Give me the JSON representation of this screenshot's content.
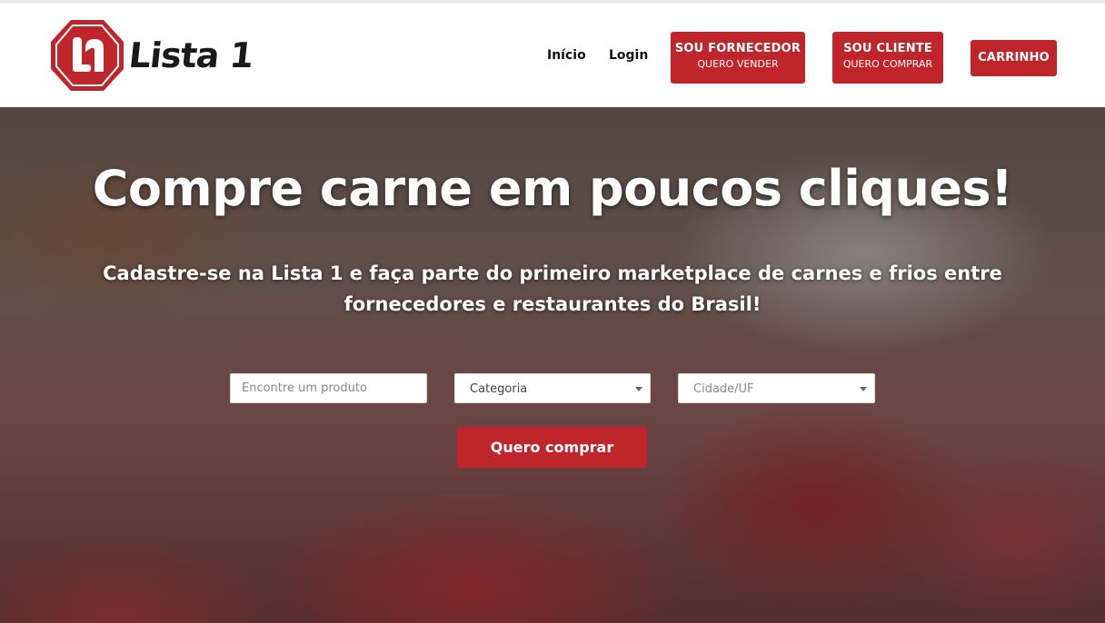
{
  "brand": {
    "name": "Lista 1",
    "badge_letters": "L1",
    "accent_color": "#c0252b"
  },
  "nav": {
    "inicio": "Início",
    "login": "Login",
    "fornecedor_line1": "SOU FORNECEDOR",
    "fornecedor_line2": "QUERO VENDER",
    "cliente_line1": "SOU CLIENTE",
    "cliente_line2": "QUERO COMPRAR",
    "carrinho": "CARRINHO"
  },
  "hero": {
    "title": "Compre carne em poucos cliques!",
    "subtitle": "Cadastre-se na Lista 1 e faça parte do primeiro marketplace de carnes e frios entre fornecedores e restaurantes do Brasil!",
    "background_icon": "meat-display-photo"
  },
  "search": {
    "product_placeholder": "Encontre um produto",
    "categoria_selected": "Categoria",
    "cidade_selected": "Cidade/UF",
    "submit_label": "Quero comprar"
  }
}
